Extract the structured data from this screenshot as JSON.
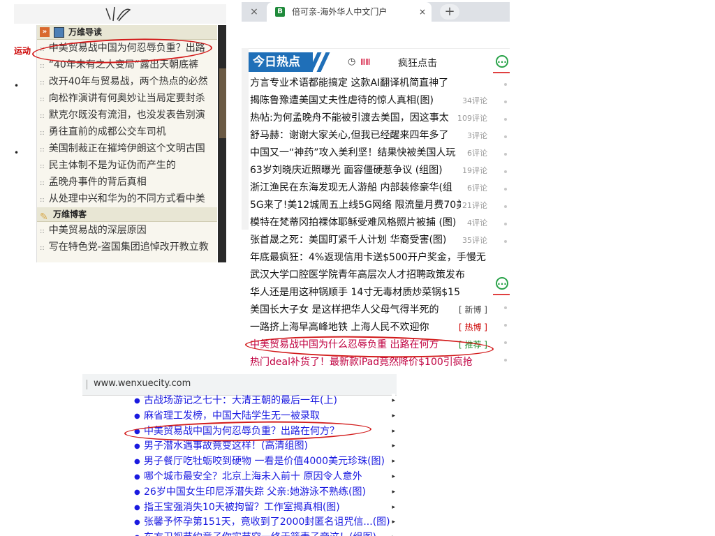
{
  "panel_a": {
    "left_label": "运动",
    "section1": {
      "title": "万维导读",
      "chevron": "»",
      "icon": "book-icon"
    },
    "items1": [
      "中美贸易战中国为何忍辱负重？出路",
      "“40年未有之大变局”露出天朝底裤",
      "改开40年与贸易战，两个热点的必然",
      "向松祚演讲有何奥妙让当局定要封杀",
      "默克尔既没有流泪，也没发表告别演",
      "勇往直前的成都公交车司机",
      "美国制裁正在摧垮伊朗这个文明古国",
      "民主体制不是为证伪而产生的",
      "孟晚舟事件的背后真相",
      "从处理中兴和华为的不同方式看中美"
    ],
    "section2": {
      "title": "万维博客",
      "icon": "pencil-icon"
    },
    "items2": [
      "中美贸易战的深层原因",
      "写在特色党-盗国集团追悼改开教立教"
    ]
  },
  "panel_b": {
    "tabs": {
      "prev_close": "×",
      "active_title": "倍可亲-海外华人中文门户",
      "active_icon_letter": "B",
      "close": "×",
      "new_tab": "+"
    },
    "header": {
      "hot_label": "今日热点",
      "crazy_click": "疯狂点击",
      "clock_icon": "clock-icon"
    },
    "news": [
      {
        "title": "方言专业术语都能搞定 这款AI翻译机简直神了"
      },
      {
        "title": "揭陈鲁豫遭美国丈夫性虐待的惊人真相(图)",
        "comments": "34评论"
      },
      {
        "title": "热帖:为何孟晚舟不能被引渡去美国，因这事太",
        "comments": "109评论"
      },
      {
        "title": "舒马赫：谢谢大家关心,但我已经醒来四年多了",
        "comments": "3评论"
      },
      {
        "title": "中国又一“神药”攻入美利坚！结果快被美国人玩",
        "comments": "6评论"
      },
      {
        "title": "63岁刘晓庆近照曝光 面容僵硬惹争议 (组图)",
        "comments": "19评论"
      },
      {
        "title": "浙江渔民在东海发现无人游船 内部装修豪华(组",
        "comments": "6评论"
      },
      {
        "title": "5G来了!美12城周五上线5G网络 限流量月费70美",
        "comments": "21评论"
      },
      {
        "title": "模特在梵蒂冈拍裸体耶稣受难风格照片被捕 (图)",
        "comments": "4评论"
      },
      {
        "title": "张首晟之死：美国盯紧千人计划 华裔受害(图)",
        "comments": "35评论"
      },
      {
        "title": "年底最疯狂：4%返现信用卡送$500开户奖金，手慢无!"
      },
      {
        "title": "武汉大学口腔医学院青年高层次人才招聘政策发布"
      },
      {
        "title": "华人还是用这种锅顺手 14寸无毒材质炒菜锅$15"
      },
      {
        "title": "美国长大子女 是这样把华人父母气得半死的",
        "tag": "[ 新博 ]",
        "tag_style": "black"
      },
      {
        "title": "一路挤上海早高峰地铁 上海人民不欢迎你",
        "tag": "[ 热博 ]",
        "tag_style": "red"
      },
      {
        "title": "中美贸易战中国为什么忍辱负重 出路在何方",
        "tag": "[ 推荐 ]",
        "tag_style": "green",
        "text_style": "red"
      },
      {
        "title": "热门deal补货了！最新款iPad竟然降价$100引疯抢",
        "text_style": "red"
      }
    ],
    "side_icon": "more-icon"
  },
  "panel_c": {
    "url": "www.wenxuecity.com",
    "items": [
      "古战场游记之七十：大清王朝的最后一年(上)",
      "麻省理工发榜，中国大陆学生无一被录取",
      "中美贸易战中国为何忍辱负重？出路在何方？",
      "男子潜水遇事故竟变这样！(高清组图)",
      "男子餐厅吃牡蛎咬到硬物 一看是价值4000美元珍珠(图)",
      "哪个城市最安全？北京上海未入前十 原因令人意外",
      "26岁中国女生印尼浮潜失踪 父亲:她游泳不熟练(图)",
      "指王宝强消失10天被拘留？工作室揭真相(图)",
      "张馨予怀孕第151天，竟收到了2000封匿名诅咒信...(图)",
      "东方卫视节约竟子你实节空一终于篮麦子帝这！(组图)"
    ]
  },
  "colors": {
    "annotation_red": "#d21a1a",
    "hot_blue": "#1f6fb8",
    "link_blue": "#1a1ae0",
    "tag_green": "#1a8a2a",
    "accent_green": "#2aa34a"
  }
}
